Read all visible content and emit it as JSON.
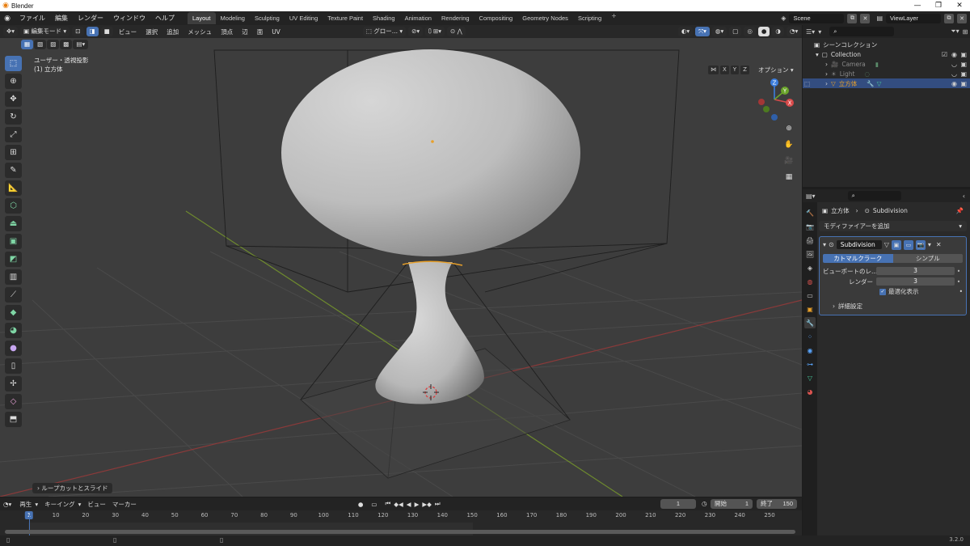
{
  "window": {
    "title": "Blender",
    "controls": [
      "—",
      "❐",
      "✕"
    ]
  },
  "menubar": {
    "menus": [
      "ファイル",
      "編集",
      "レンダー",
      "ウィンドウ",
      "ヘルプ"
    ],
    "workspaces": [
      "Layout",
      "Modeling",
      "Sculpting",
      "UV Editing",
      "Texture Paint",
      "Shading",
      "Animation",
      "Rendering",
      "Compositing",
      "Geometry Nodes",
      "Scripting"
    ],
    "active_workspace": "Layout",
    "add_tab": "+",
    "scene": "Scene",
    "view_layer": "ViewLayer"
  },
  "viewport": {
    "mode": "編集モード",
    "menus": [
      "ビュー",
      "選択",
      "追加",
      "メッシュ",
      "頂点",
      "辺",
      "面",
      "UV"
    ],
    "orientation": "グロー...",
    "view_name": "ユーザー・透視投影",
    "object_label": "(1) 立方体",
    "options_label": "オプション",
    "axes": [
      "X",
      "Y",
      "Z"
    ],
    "last_operator": "ループカットとスライド",
    "gizmo": {
      "x": "X",
      "y": "Y",
      "z": "Z"
    }
  },
  "outliner": {
    "root": "シーンコレクション",
    "collection": "Collection",
    "items": [
      {
        "name": "Camera",
        "dim": true
      },
      {
        "name": "Light",
        "dim": true
      },
      {
        "name": "立方体",
        "dim": false,
        "selected": true
      }
    ]
  },
  "properties": {
    "breadcrumb_object": "立方体",
    "breadcrumb_modifier": "Subdivision",
    "add_modifier": "モディファイアーを追加",
    "modifier_name": "Subdivision",
    "algo_catmull": "カトマルクラーク",
    "algo_simple": "シンプル",
    "viewport_label": "ビューポートのレ...",
    "viewport_levels": "3",
    "render_label": "レンダー",
    "render_levels": "3",
    "optimal_display": "最適化表示",
    "advanced": "詳細設定"
  },
  "timeline": {
    "menus": [
      "再生",
      "キーイング",
      "ビュー",
      "マーカー"
    ],
    "current_frame": "1",
    "start_label": "開始",
    "start": "1",
    "end_label": "終了",
    "end": "150",
    "ticks": [
      "10",
      "20",
      "30",
      "40",
      "50",
      "60",
      "70",
      "80",
      "90",
      "100",
      "110",
      "120",
      "130",
      "140",
      "150",
      "160",
      "170",
      "180",
      "190",
      "200",
      "210",
      "220",
      "230",
      "240",
      "250"
    ],
    "cursor_label": "1"
  },
  "status": {
    "version": "3.2.0"
  },
  "colors": {
    "accent": "#4772b3",
    "viewport_bg": "#3d3d3d",
    "selection_orange": "#e8a02a"
  }
}
